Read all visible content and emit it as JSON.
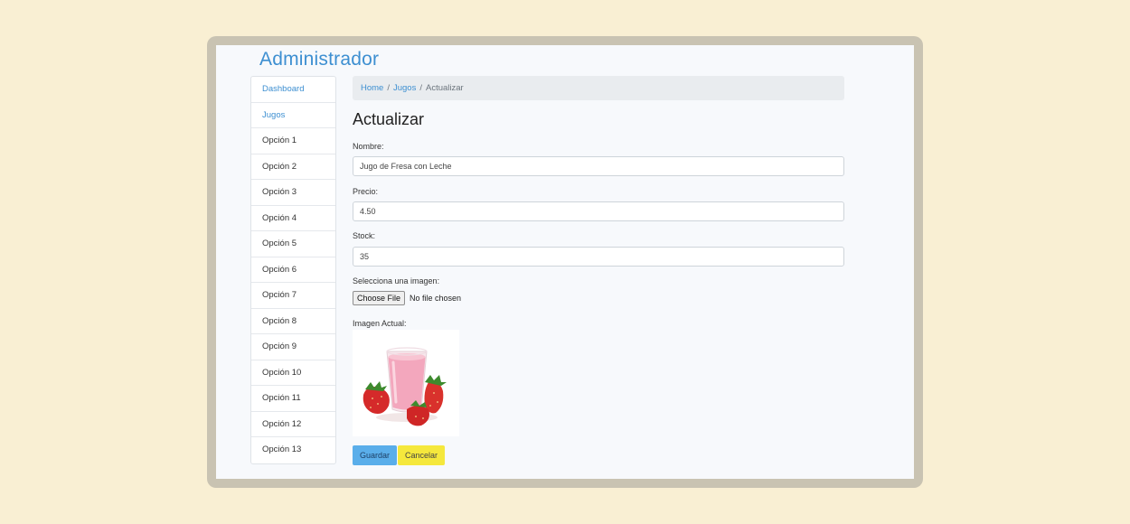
{
  "app": {
    "title": "Administrador"
  },
  "sidebar": {
    "items": [
      {
        "label": "Dashboard"
      },
      {
        "label": "Jugos"
      },
      {
        "label": "Opción 1"
      },
      {
        "label": "Opción 2"
      },
      {
        "label": "Opción 3"
      },
      {
        "label": "Opción 4"
      },
      {
        "label": "Opción 5"
      },
      {
        "label": "Opción 6"
      },
      {
        "label": "Opción 7"
      },
      {
        "label": "Opción 8"
      },
      {
        "label": "Opción 9"
      },
      {
        "label": "Opción 10"
      },
      {
        "label": "Opción 11"
      },
      {
        "label": "Opción 12"
      },
      {
        "label": "Opción 13"
      }
    ]
  },
  "breadcrumb": {
    "home": "Home",
    "section": "Jugos",
    "current": "Actualizar",
    "separator": "/"
  },
  "form": {
    "title": "Actualizar",
    "nombre": {
      "label": "Nombre:",
      "value": "Jugo de Fresa con Leche"
    },
    "precio": {
      "label": "Precio:",
      "value": "4.50"
    },
    "stock": {
      "label": "Stock:",
      "value": "35"
    },
    "imagen": {
      "label": "Selecciona una imagen:",
      "button": "Choose File",
      "status": "No file chosen"
    },
    "imagen_actual": {
      "label": "Imagen Actual:"
    },
    "save_label": "Guardar",
    "cancel_label": "Cancelar"
  },
  "colors": {
    "accent": "#3d8fd1",
    "page_bg": "#f9efd3",
    "frame": "#c9c3b2",
    "save_button": "#5aaeea",
    "cancel_button": "#f5e83c"
  }
}
